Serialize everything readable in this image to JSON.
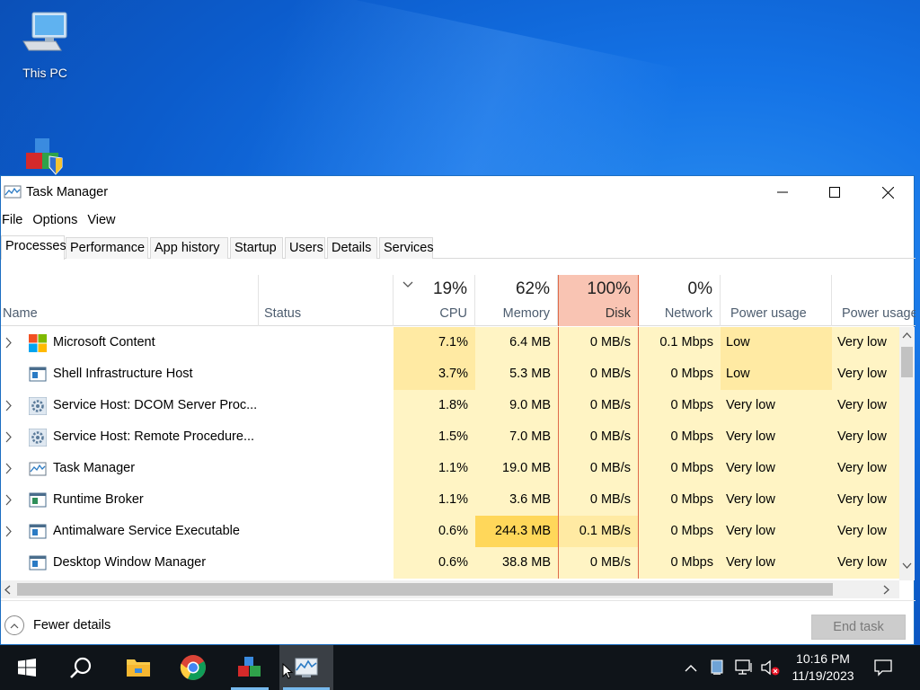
{
  "desktop": {
    "icons": [
      {
        "label": "This PC",
        "icon": "computer-icon"
      },
      {
        "label": "",
        "icon": "app-blocks-icon"
      }
    ]
  },
  "window": {
    "title": "Task Manager",
    "menu": [
      "File",
      "Options",
      "View"
    ],
    "tabs": [
      "Processes",
      "Performance",
      "App history",
      "Startup",
      "Users",
      "Details",
      "Services"
    ],
    "active_tab": "Processes",
    "columns": {
      "name": "Name",
      "status": "Status",
      "cpu": {
        "pct": "19%",
        "label": "CPU"
      },
      "memory": {
        "pct": "62%",
        "label": "Memory"
      },
      "disk": {
        "pct": "100%",
        "label": "Disk"
      },
      "network": {
        "pct": "0%",
        "label": "Network"
      },
      "power": "Power usage",
      "power_trend": "Power usage"
    },
    "processes": [
      {
        "name": "Microsoft Content",
        "icon": "ms-store-icon",
        "expandable": true,
        "cpu": "7.1%",
        "memory": "6.4 MB",
        "disk": "0 MB/s",
        "network": "0.1 Mbps",
        "power": "Low",
        "power_trend": "Very low"
      },
      {
        "name": "Shell Infrastructure Host",
        "icon": "window-icon",
        "expandable": false,
        "cpu": "3.7%",
        "memory": "5.3 MB",
        "disk": "0 MB/s",
        "network": "0 Mbps",
        "power": "Low",
        "power_trend": "Very low"
      },
      {
        "name": "Service Host: DCOM Server Proc...",
        "icon": "gear-icon",
        "expandable": true,
        "cpu": "1.8%",
        "memory": "9.0 MB",
        "disk": "0 MB/s",
        "network": "0 Mbps",
        "power": "Very low",
        "power_trend": "Very low"
      },
      {
        "name": "Service Host: Remote Procedure...",
        "icon": "gear-icon",
        "expandable": true,
        "cpu": "1.5%",
        "memory": "7.0 MB",
        "disk": "0 MB/s",
        "network": "0 Mbps",
        "power": "Very low",
        "power_trend": "Very low"
      },
      {
        "name": "Task Manager",
        "icon": "task-manager-icon",
        "expandable": true,
        "cpu": "1.1%",
        "memory": "19.0 MB",
        "disk": "0 MB/s",
        "network": "0 Mbps",
        "power": "Very low",
        "power_trend": "Very low"
      },
      {
        "name": "Runtime Broker",
        "icon": "window-icon",
        "expandable": true,
        "cpu": "1.1%",
        "memory": "3.6 MB",
        "disk": "0 MB/s",
        "network": "0 Mbps",
        "power": "Very low",
        "power_trend": "Very low"
      },
      {
        "name": "Antimalware Service Executable",
        "icon": "window-icon",
        "expandable": true,
        "cpu": "0.6%",
        "memory": "244.3 MB",
        "disk": "0.1 MB/s",
        "network": "0 Mbps",
        "power": "Very low",
        "power_trend": "Very low"
      },
      {
        "name": "Desktop Window Manager",
        "icon": "window-icon",
        "expandable": false,
        "cpu": "0.6%",
        "memory": "38.8 MB",
        "disk": "0 MB/s",
        "network": "0 Mbps",
        "power": "Very low",
        "power_trend": "Very low"
      }
    ],
    "footer": {
      "fewer_details": "Fewer details",
      "end_task": "End task"
    }
  },
  "taskbar": {
    "items": [
      "start-icon",
      "search-icon",
      "file-explorer-icon",
      "chrome-icon",
      "app-blocks-icon",
      "task-manager-icon"
    ],
    "clock": {
      "time": "10:16 PM",
      "date": "11/19/2023"
    }
  },
  "colors": {
    "accent": "#0078d7",
    "heat_low": "#fff4c4",
    "heat_mid": "#ffeaa3",
    "heat_high": "#ffd75a",
    "disk_header": "#f9c4b3"
  }
}
